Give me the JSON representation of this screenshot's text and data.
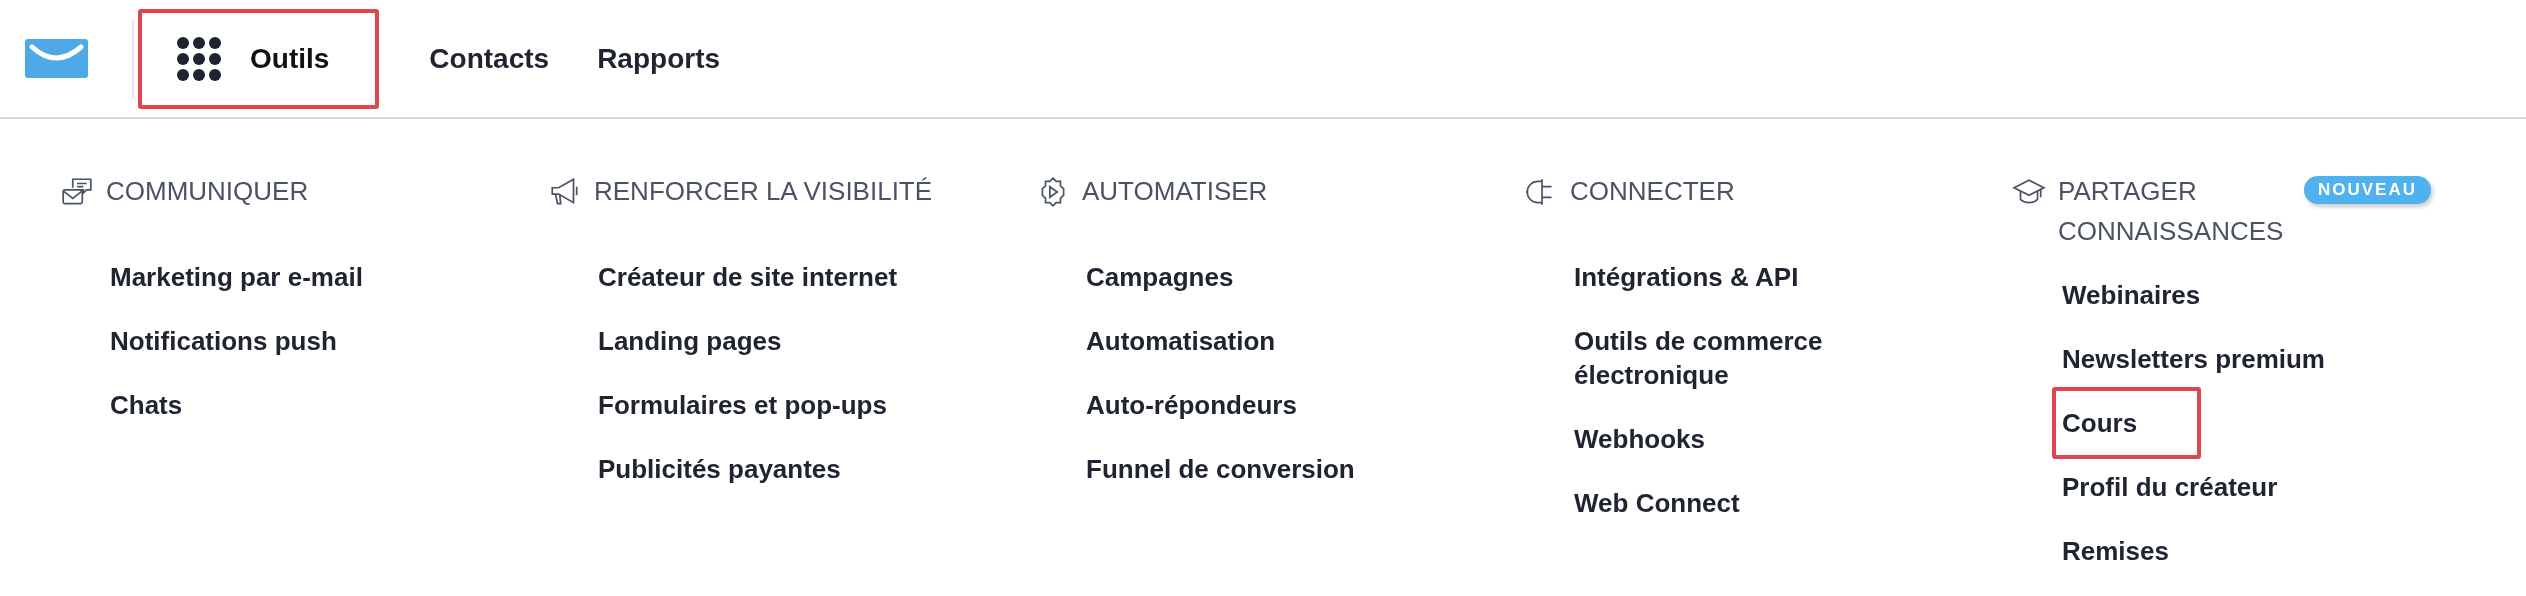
{
  "nav": [
    {
      "label": "Outils",
      "kind": "menu",
      "selected": true,
      "highlighted": true
    },
    {
      "label": "Contacts",
      "kind": "link",
      "selected": false,
      "highlighted": false
    },
    {
      "label": "Rapports",
      "kind": "link",
      "selected": false,
      "highlighted": false
    }
  ],
  "columns": [
    {
      "title": "COMMUNIQUER",
      "kind": "chat",
      "items": [
        {
          "label": "Marketing par e-mail",
          "highlighted": false
        },
        {
          "label": "Notifications push",
          "highlighted": false
        },
        {
          "label": "Chats",
          "highlighted": false
        }
      ]
    },
    {
      "title": "RENFORCER LA VISIBILITÉ",
      "kind": "megaphone",
      "items": [
        {
          "label": "Créateur de site internet",
          "highlighted": false
        },
        {
          "label": "Landing pages",
          "highlighted": false
        },
        {
          "label": "Formulaires et pop-ups",
          "highlighted": false
        },
        {
          "label": "Publicités payantes",
          "highlighted": false
        }
      ]
    },
    {
      "title": "AUTOMATISER",
      "kind": "gear",
      "items": [
        {
          "label": "Campagnes",
          "highlighted": false
        },
        {
          "label": "Automatisation",
          "highlighted": false
        },
        {
          "label": "Auto-répondeurs",
          "highlighted": false
        },
        {
          "label": "Funnel de conversion",
          "highlighted": false
        }
      ]
    },
    {
      "title": "CONNECTER",
      "kind": "plug",
      "items": [
        {
          "label": "Intégrations & API",
          "highlighted": false
        },
        {
          "label": "Outils de commerce électronique",
          "highlighted": false
        },
        {
          "label": "Webhooks",
          "highlighted": false
        },
        {
          "label": "Web Connect",
          "highlighted": false
        }
      ]
    },
    {
      "title": "PARTAGER CONNAISSANCES",
      "kind": "cap",
      "badge": "NOUVEAU",
      "items": [
        {
          "label": "Webinaires",
          "highlighted": false
        },
        {
          "label": "Newsletters premium",
          "highlighted": false
        },
        {
          "label": "Cours",
          "highlighted": true
        },
        {
          "label": "Profil du créateur",
          "highlighted": false
        },
        {
          "label": "Remises",
          "highlighted": false
        }
      ]
    }
  ]
}
